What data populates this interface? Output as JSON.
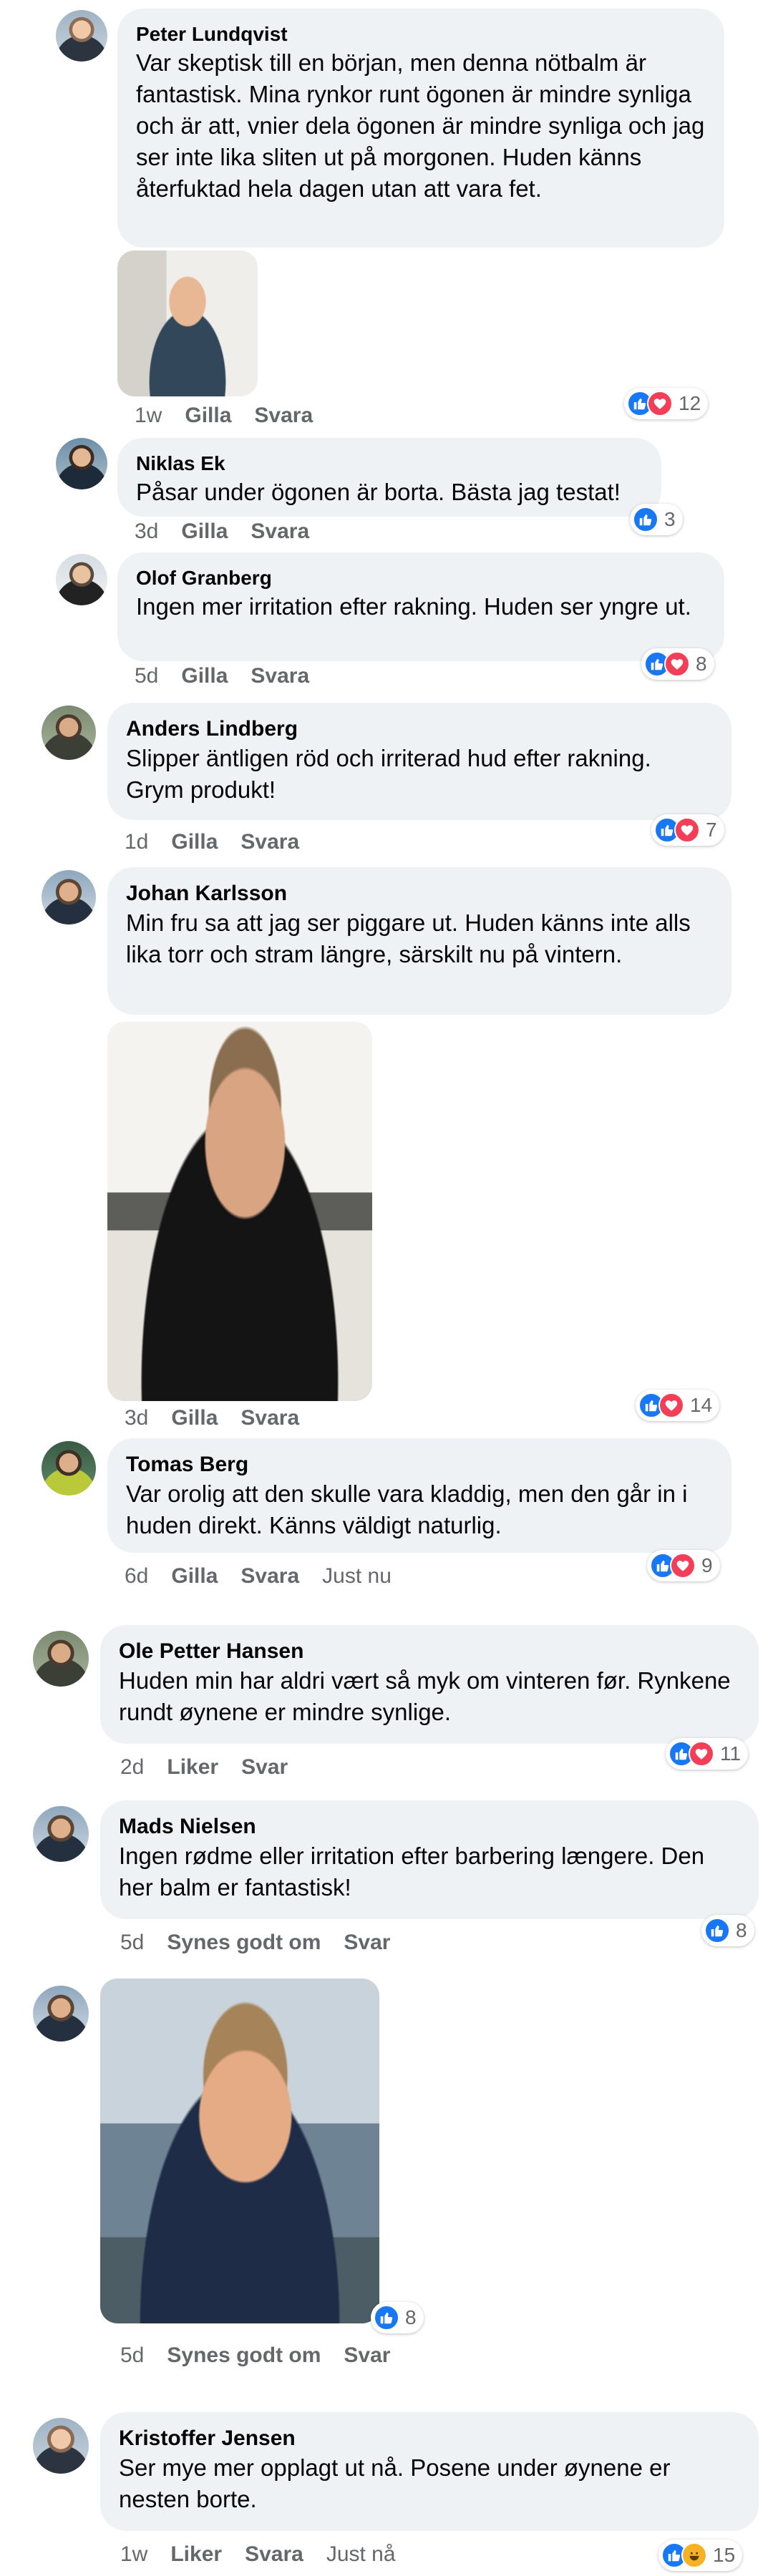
{
  "section1": {
    "comments": [
      {
        "author": "Peter Lundqvist",
        "text": "Var skeptisk till en början, men denna nötbalm är fantastisk. Mina rynkor runt ögonen är mindre synliga  och är att, vnier dela ögonen är mindre synliga och jag ser inte lika sliten ut på morgonen. Huden känns återfuktad hela dagen utan att vara fet.",
        "time": "1w",
        "like": "Gilla",
        "reply": "Svara",
        "reactions": "12"
      },
      {
        "author": "Niklas Ek",
        "text": "Påsar under ögonen är borta. Bästa jag testat!",
        "time": "3d",
        "like": "Gilla",
        "reply": "Svara",
        "reactions": "3"
      },
      {
        "author": "Olof Granberg",
        "text": "Ingen mer irritation efter rakning. Huden ser yngre ut.",
        "time": "5d",
        "like": "Gilla",
        "reply": "Svara",
        "reactions": "8"
      }
    ]
  },
  "section2": {
    "comments": [
      {
        "author": "Anders Lindberg",
        "text": "Slipper äntligen röd och irriterad hud efter rakning. Grym produkt!",
        "time": "1d",
        "like": "Gilla",
        "reply": "Svara",
        "reactions": "7"
      },
      {
        "author": "Johan Karlsson",
        "text": "Min fru sa att jag ser piggare ut. Huden känns inte alls lika torr och stram längre, särskilt nu på vintern.",
        "time": "3d",
        "like": "Gilla",
        "reply": "Svara",
        "reactions": "14"
      },
      {
        "author": "Tomas Berg",
        "text": "Var orolig att den skulle vara kladdig, men den går in i huden direkt. Känns väldigt naturlig.",
        "time": "6d",
        "like": "Gilla",
        "reply": "Svara",
        "extra": "Just nu",
        "reactions": "9"
      }
    ]
  },
  "section3": {
    "comments": [
      {
        "author": "Ole Petter Hansen",
        "text": "Huden min har aldri vært så myk om vinteren før. Rynkene rundt øynene er mindre synlige.",
        "time": "2d",
        "like": "Liker",
        "reply": "Svar",
        "reactions": "11"
      },
      {
        "author": "Mads Nielsen",
        "text": "Ingen rødme eller irritation efter barbering længere. Den her balm er fantastisk!",
        "time": "5d",
        "like": "Synes godt om",
        "reply": "Svar",
        "reactions": "8"
      },
      {
        "time": "5d",
        "like": "Synes godt om",
        "reply": "Svar",
        "reactions": "8"
      },
      {
        "author": "Kristoffer Jensen",
        "text": "Ser mye mer opplagt ut nå. Posene under øynene er nesten borte.",
        "time": "1w",
        "like": "Liker",
        "reply": "Svara",
        "extra": "Just nå",
        "reactions": "15"
      }
    ]
  },
  "colors": {
    "bubble": "#eff2f5",
    "meta_text": "#65676b",
    "like_blue": "#1877f2",
    "love_red": "#f33e58",
    "haha_yellow": "#f7b125"
  },
  "icons": [
    "like-icon",
    "love-icon",
    "haha-icon"
  ]
}
